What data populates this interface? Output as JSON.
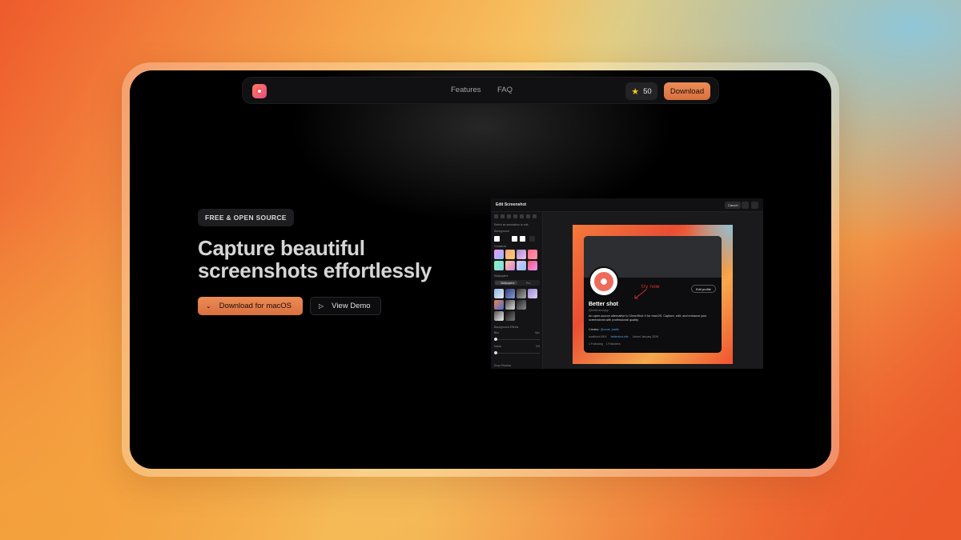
{
  "nav": {
    "links": [
      "Features",
      "FAQ"
    ],
    "star_count": "50",
    "download_label": "Download"
  },
  "hero": {
    "badge": "FREE & OPEN SOURCE",
    "headline": "Capture beautiful screenshots effortlessly",
    "primary_cta": "Download for macOS",
    "secondary_cta": "View Demo"
  },
  "preview": {
    "window_title": "Edit Screenshot",
    "cancel_label": "Cancel",
    "sidebar": {
      "hint": "Select an annotation to edit",
      "background_label": "Background",
      "gradients_label": "Gradients",
      "wallpapers_label": "Wallpapers",
      "tabs": [
        "Wallpapers",
        "Pro"
      ],
      "effects_label": "Background Effects",
      "blur_label": "Blur",
      "blur_value": "0px",
      "noise_label": "Noise",
      "noise_value": "0%",
      "shadow_label": "Drop Shadow"
    },
    "profile": {
      "edit_label": "Edit profile",
      "annotation": "try now",
      "name": "Better shot",
      "handle": "@bettershotapp",
      "bio": "An open-source alternative to CleanShot X for macOS. Capture, edit, and enhance your screenshots with professional quality.",
      "creator_prefix": "Creator:",
      "creator_handle": "@code_kartik",
      "location": "localhost:3000",
      "website": "bettershot.site",
      "joined": "Joined January 2026",
      "following": "1 Following",
      "followers": "1 Followers"
    }
  },
  "colors": {
    "accent": "#e07a45",
    "page_bg": "#000000",
    "star": "#f5c518"
  },
  "icons": [
    "app-logo-icon",
    "star-icon",
    "chevron-down-icon",
    "play-icon"
  ]
}
